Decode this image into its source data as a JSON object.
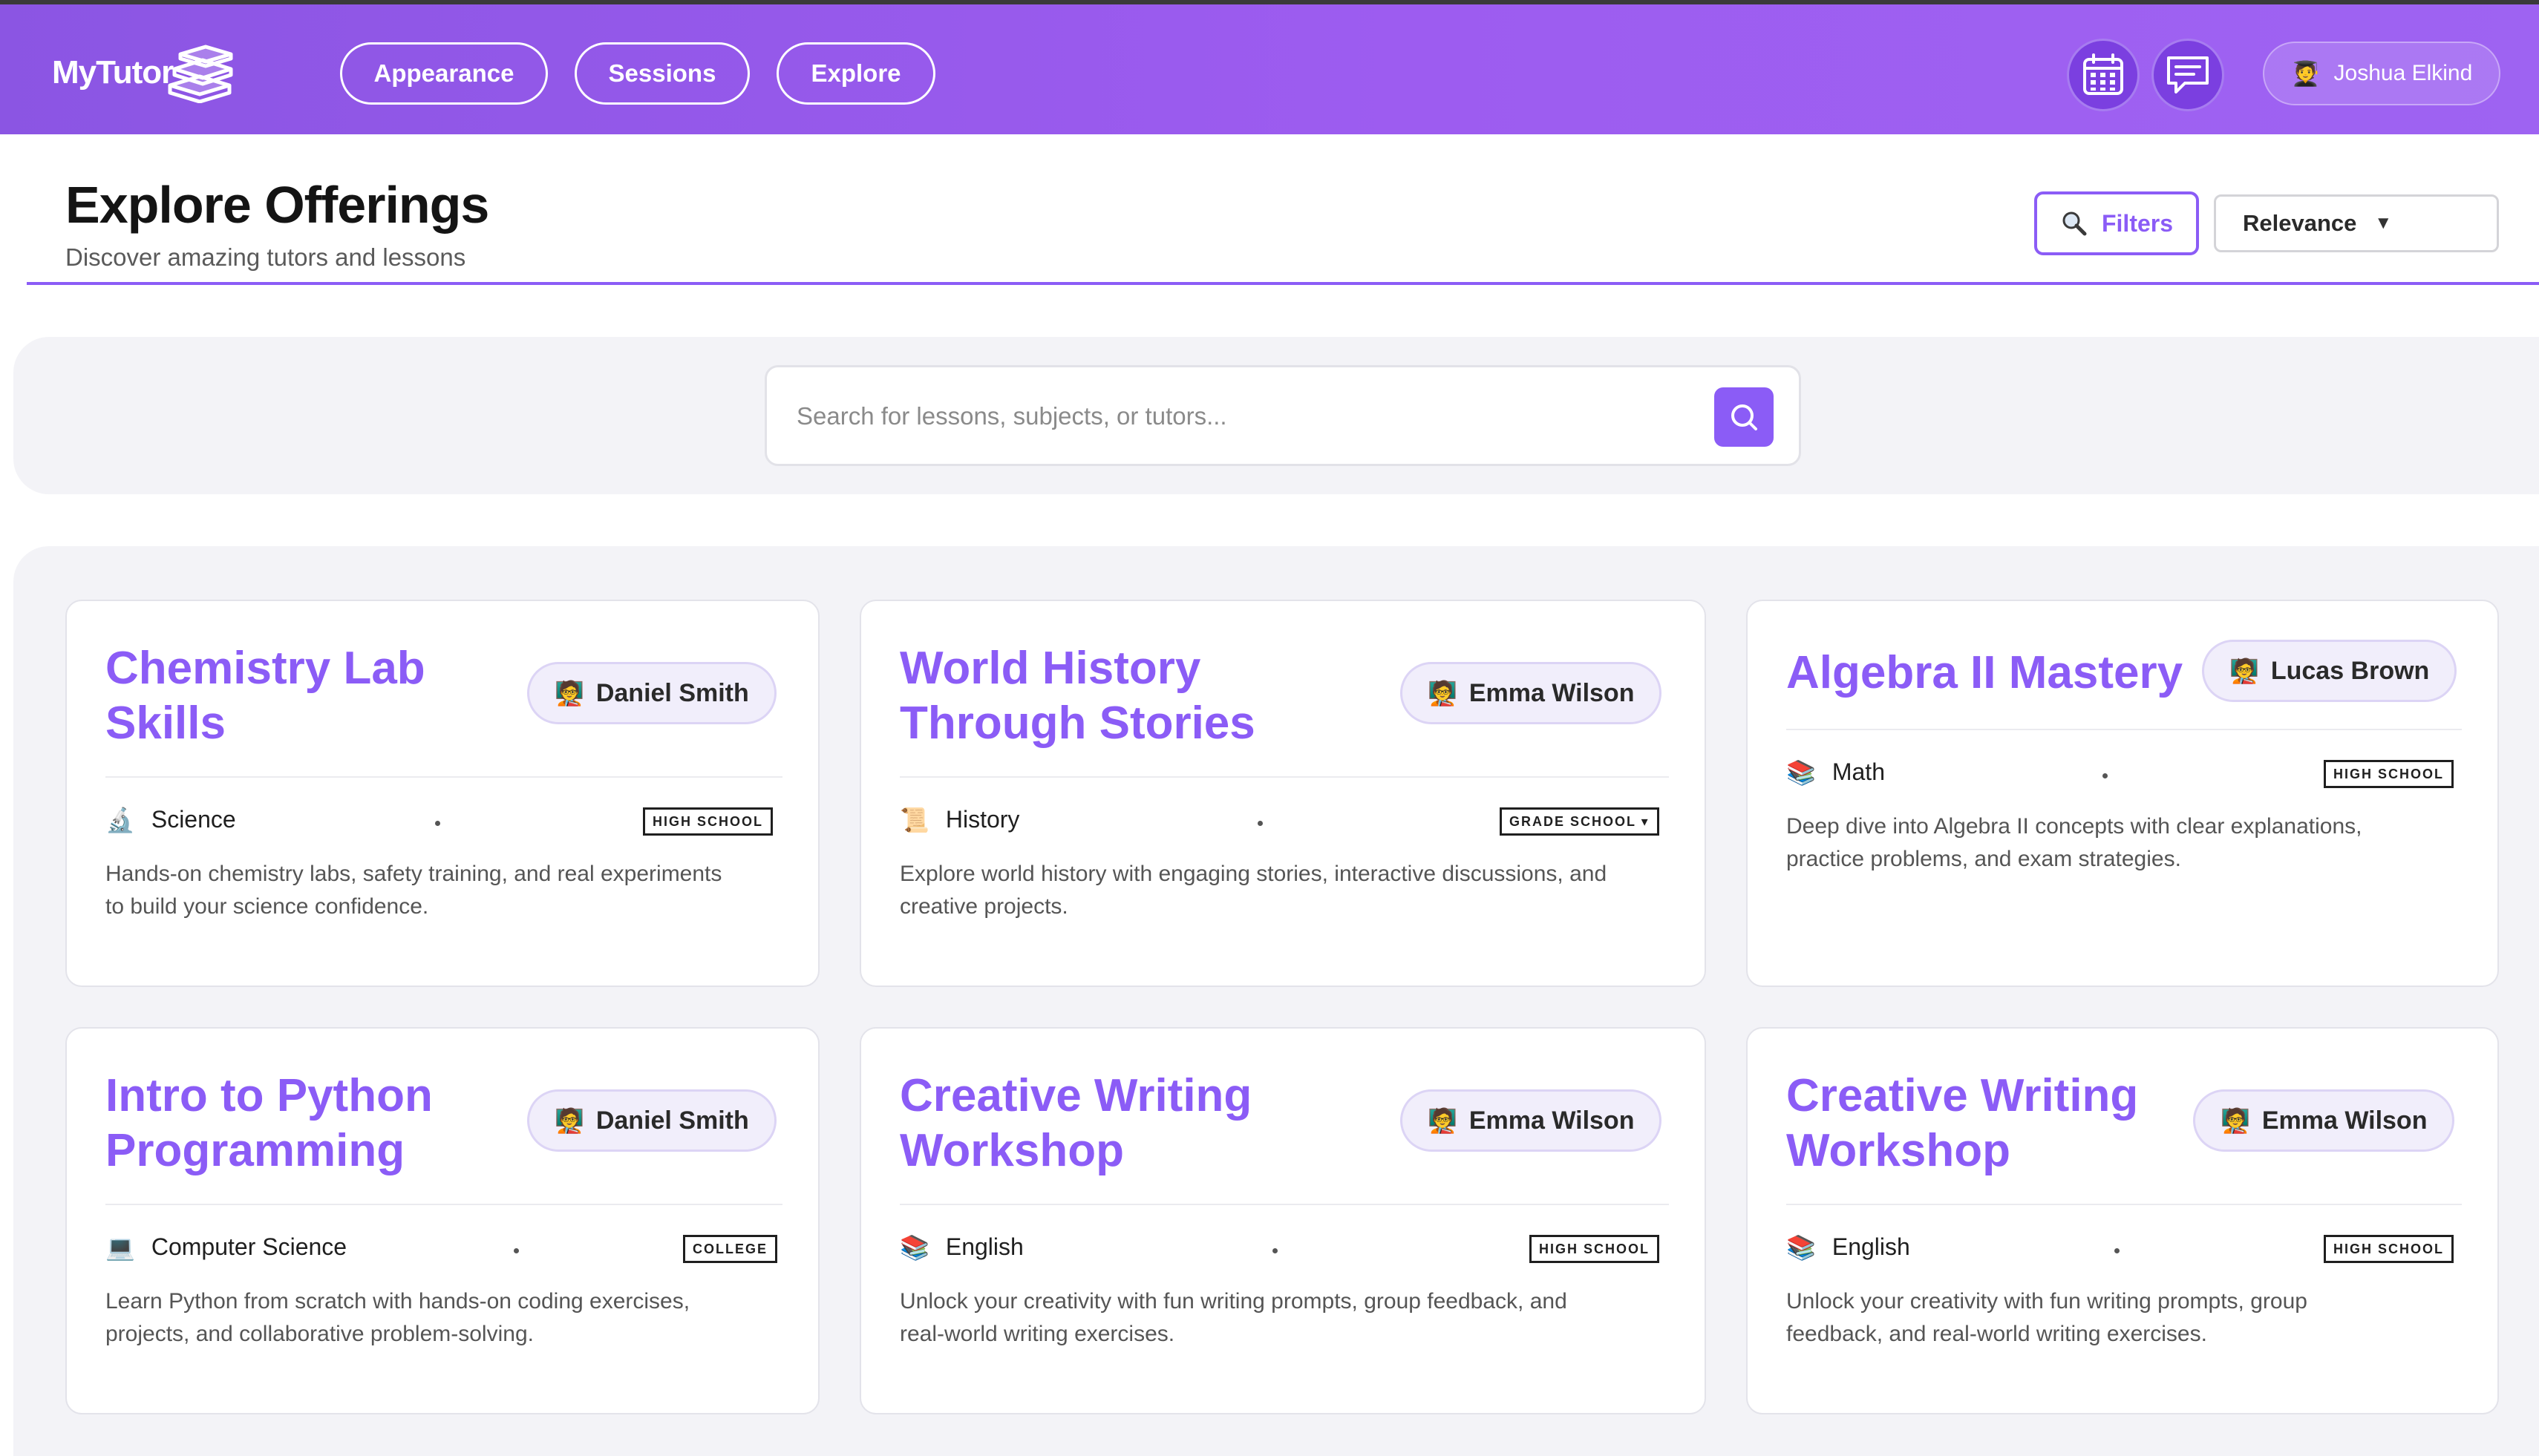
{
  "app": {
    "brand": "MyTutor",
    "nav": [
      "Appearance",
      "Sessions",
      "Explore"
    ],
    "user_name": "Joshua Elkind",
    "user_icon": "🧑‍🎓"
  },
  "page": {
    "title": "Explore Offerings",
    "subtitle": "Discover amazing tutors and lessons",
    "filters_label": "Filters",
    "sort_value": "Relevance",
    "sort_caret": "▼"
  },
  "search": {
    "placeholder": "Search for lessons, subjects, or tutors..."
  },
  "offerings": [
    {
      "title_lines": [
        "Chemistry Lab",
        "Skills"
      ],
      "tutor": "Daniel Smith",
      "subject_icon": "🔬",
      "subject": "Science",
      "level": "HIGH SCHOOL",
      "description_lines": [
        "Hands-on chemistry labs, safety training, and real experiments",
        "to build your science confidence."
      ]
    },
    {
      "title_lines": [
        "World History",
        "Through Stories"
      ],
      "tutor": "Emma Wilson",
      "subject_icon": "📜",
      "subject": "History",
      "level": "GRADE SCHOOL ▾",
      "description_lines": [
        "Explore world history with engaging stories, interactive discussions, and",
        "creative projects."
      ]
    },
    {
      "title_lines": [
        "Algebra II Mastery"
      ],
      "tutor": "Lucas Brown",
      "subject_icon": "📚",
      "subject": "Math",
      "level": "HIGH SCHOOL",
      "description_lines": [
        "Deep dive into Algebra II concepts with clear explanations,",
        "practice problems, and exam strategies."
      ]
    },
    {
      "title_lines": [
        "Intro to Python",
        "Programming"
      ],
      "tutor": "Daniel Smith",
      "subject_icon": "💻",
      "subject": "Computer Science",
      "level": "COLLEGE",
      "description_lines": [
        "Learn Python from scratch with hands-on coding exercises,",
        "projects, and collaborative problem-solving."
      ]
    },
    {
      "title_lines": [
        "Creative Writing",
        "Workshop"
      ],
      "tutor": "Emma Wilson",
      "subject_icon": "📚",
      "subject": "English",
      "level": "HIGH SCHOOL",
      "description_lines": [
        "Unlock your creativity with fun writing prompts, group feedback, and",
        "real-world writing exercises."
      ]
    },
    {
      "title_lines": [
        "Creative Writing",
        "Workshop"
      ],
      "tutor": "Emma Wilson",
      "subject_icon": "📚",
      "subject": "English",
      "level": "HIGH SCHOOL",
      "description_lines": [
        "Unlock your creativity with fun writing prompts, group",
        "feedback, and real-world writing exercises."
      ]
    }
  ],
  "tutor_icon": "🧑‍🏫",
  "icons": {
    "calendar": "calendar-icon",
    "messages": "chat-icon",
    "search": "search-icon",
    "filters": "magnifier-icon"
  },
  "colors": {
    "accent": "#8b5cf6",
    "header_gradient_start": "#8b55e3",
    "header_gradient_end": "#9e63f2"
  }
}
